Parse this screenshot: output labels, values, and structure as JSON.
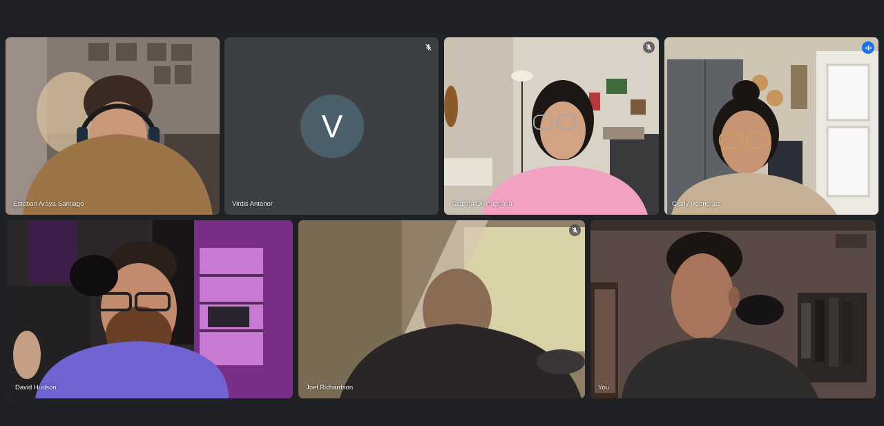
{
  "participants": [
    {
      "name": "Esteban Araya-Santiago",
      "muted": false
    },
    {
      "name": "Virdis Antenor",
      "muted": true,
      "avatar_initial": "V",
      "avatar_color": "#4b5f6b"
    },
    {
      "name": "Czarina Divinagracia",
      "muted": true
    },
    {
      "name": "Cindy Rodriguez",
      "speaking": true
    },
    {
      "name": "David Hudson",
      "muted": false
    },
    {
      "name": "Joel Richardson",
      "muted": true
    },
    {
      "name": "You",
      "muted": false
    }
  ],
  "icons": {
    "muted": "mic-off-icon",
    "speaking": "speaking-indicator-icon"
  },
  "colors": {
    "background": "#202124",
    "active_speaker_border": "#8ab4f8",
    "speaking_badge": "#1a73e8",
    "avatar": "#4b5f6b"
  }
}
